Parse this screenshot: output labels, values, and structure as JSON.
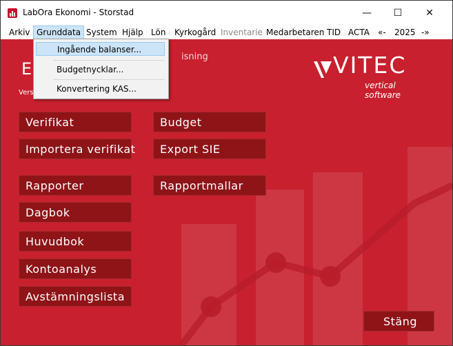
{
  "window": {
    "title": "LabOra Ekonomi  - Storstad",
    "minimize_glyph": "—",
    "maximize_glyph": "☐",
    "close_glyph": "✕"
  },
  "menubar": {
    "items": [
      {
        "label": "Arkiv"
      },
      {
        "label": "Grunddata"
      },
      {
        "label": "System"
      },
      {
        "label": "Hjälp"
      },
      {
        "label": "Lön"
      },
      {
        "label": "Kyrkogård"
      },
      {
        "label": "Inventarie"
      },
      {
        "label": "Medarbetaren"
      },
      {
        "label": "TID"
      },
      {
        "label": "ACTA"
      },
      {
        "label": "«-"
      },
      {
        "label": "2025"
      },
      {
        "label": "-»"
      }
    ]
  },
  "dropdown": {
    "items": [
      {
        "label": "Ingående balanser..."
      },
      {
        "label": "Budgetnycklar..."
      },
      {
        "label": "Konvertering KAS..."
      }
    ]
  },
  "main": {
    "heading": "E",
    "subheading": "isning",
    "version": "Vers",
    "logo": {
      "word": "VITEC",
      "tagline": "vertical software"
    },
    "buttons": {
      "verifikat": "Verifikat",
      "budget": "Budget",
      "importera_verifikat": "Importera verifikat",
      "export_sie": "Export SIE",
      "rapporter": "Rapporter",
      "rapportmallar": "Rapportmallar",
      "dagbok": "Dagbok",
      "huvudbok": "Huvudbok",
      "kontoanalys": "Kontoanalys",
      "avstamningslista": "Avstämningslista",
      "stang": "Stäng"
    }
  },
  "colors": {
    "background_red": "#c8202e",
    "button_dark_red": "#8e1418",
    "menu_highlight": "#cce4f7"
  }
}
